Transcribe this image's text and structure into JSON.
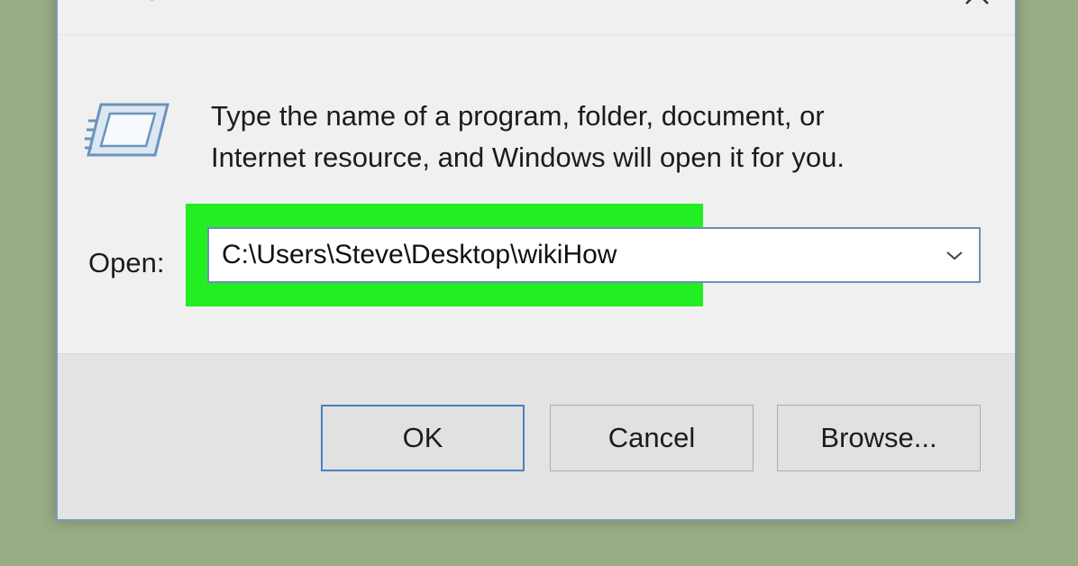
{
  "window": {
    "title": "Run"
  },
  "description": {
    "line1": "Type the name of a program, folder, document, or",
    "line2": "Internet resource, and Windows will open it for you."
  },
  "open": {
    "label": "Open:",
    "value": "C:\\Users\\Steve\\Desktop\\wikiHow"
  },
  "buttons": {
    "ok": "OK",
    "cancel": "Cancel",
    "browse": "Browse..."
  },
  "colors": {
    "highlight": "#22ee22",
    "background": "#9aac86",
    "dialog": "#f0f0f0",
    "accent_border": "#4a7fbf"
  },
  "icons": [
    "run-app-icon",
    "close-icon",
    "run-program-icon",
    "chevron-down-icon"
  ]
}
